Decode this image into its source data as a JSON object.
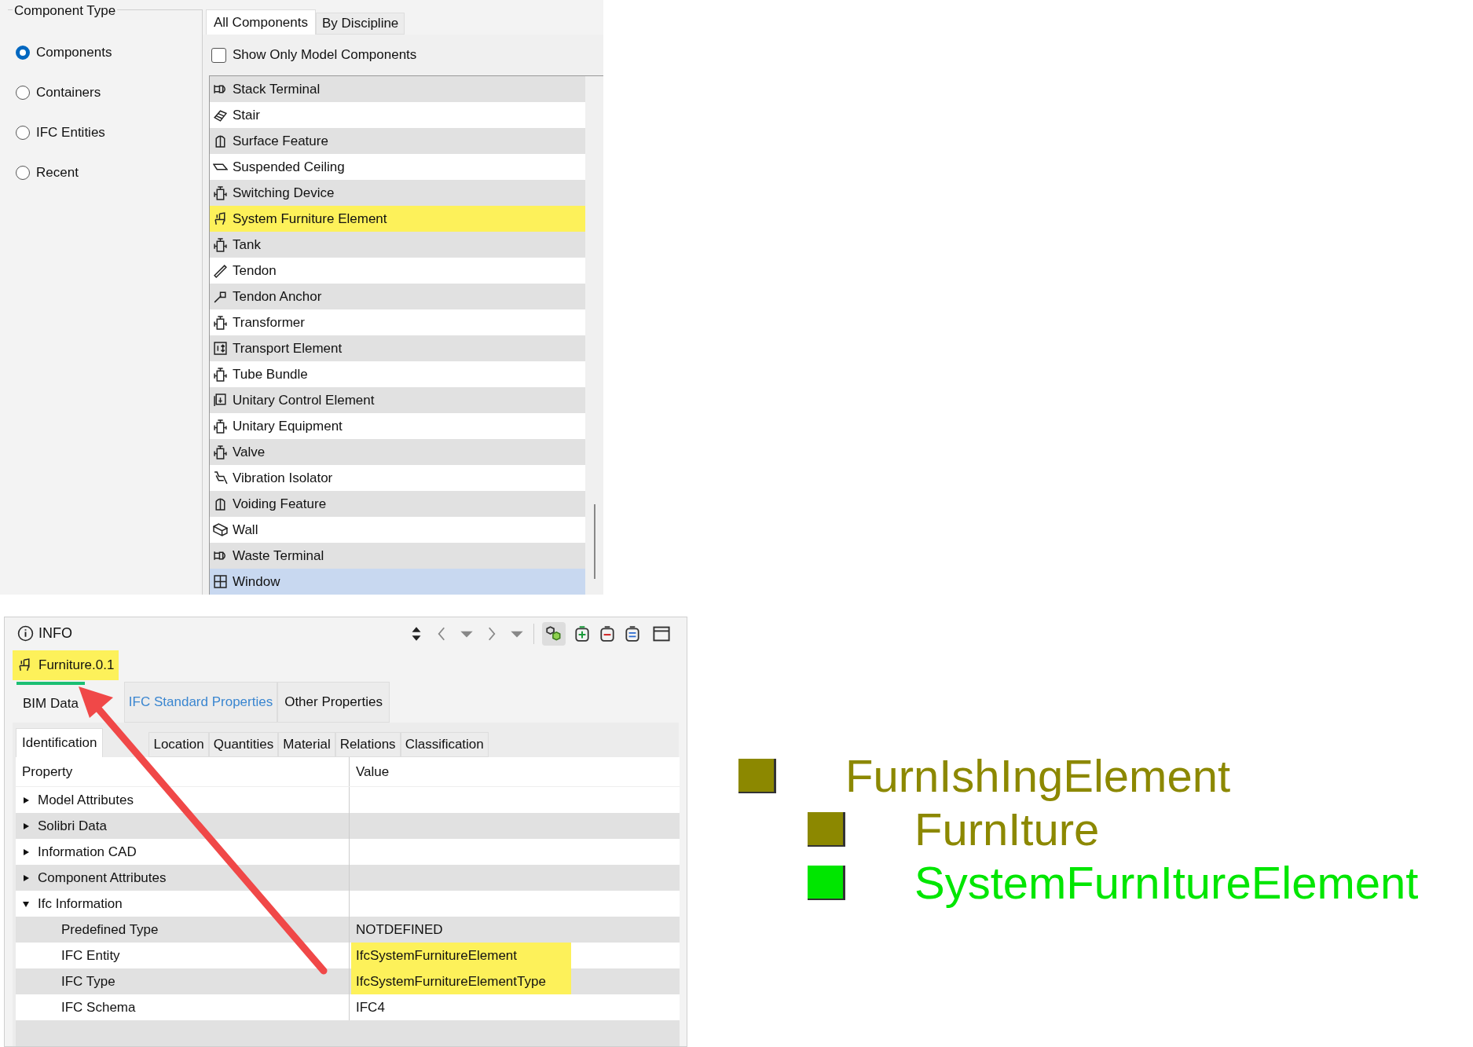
{
  "component_type": {
    "title": "Component Type",
    "options": [
      {
        "label": "Components",
        "selected": true
      },
      {
        "label": "Containers",
        "selected": false
      },
      {
        "label": "IFC Entities",
        "selected": false
      },
      {
        "label": "Recent",
        "selected": false
      }
    ]
  },
  "component_tabs": [
    {
      "label": "All Components",
      "selected": true
    },
    {
      "label": "By Discipline",
      "selected": false
    }
  ],
  "show_only_model": {
    "label": "Show Only Model Components",
    "checked": false
  },
  "components": [
    {
      "label": "Stack Terminal",
      "selected": false,
      "highlighted": false
    },
    {
      "label": "Stair",
      "selected": false,
      "highlighted": false
    },
    {
      "label": "Surface Feature",
      "selected": false,
      "highlighted": false
    },
    {
      "label": "Suspended Ceiling",
      "selected": false,
      "highlighted": false
    },
    {
      "label": "Switching Device",
      "selected": false,
      "highlighted": false
    },
    {
      "label": "System Furniture Element",
      "selected": false,
      "highlighted": true
    },
    {
      "label": "Tank",
      "selected": false,
      "highlighted": false
    },
    {
      "label": "Tendon",
      "selected": false,
      "highlighted": false
    },
    {
      "label": "Tendon Anchor",
      "selected": false,
      "highlighted": false
    },
    {
      "label": "Transformer",
      "selected": false,
      "highlighted": false
    },
    {
      "label": "Transport Element",
      "selected": false,
      "highlighted": false
    },
    {
      "label": "Tube Bundle",
      "selected": false,
      "highlighted": false
    },
    {
      "label": "Unitary Control Element",
      "selected": false,
      "highlighted": false
    },
    {
      "label": "Unitary Equipment",
      "selected": false,
      "highlighted": false
    },
    {
      "label": "Valve",
      "selected": false,
      "highlighted": false
    },
    {
      "label": "Vibration Isolator",
      "selected": false,
      "highlighted": false
    },
    {
      "label": "Voiding Feature",
      "selected": false,
      "highlighted": false
    },
    {
      "label": "Wall",
      "selected": false,
      "highlighted": false
    },
    {
      "label": "Waste Terminal",
      "selected": false,
      "highlighted": false
    },
    {
      "label": "Window",
      "selected": true,
      "highlighted": false
    }
  ],
  "info": {
    "title": "INFO",
    "object": {
      "label": "Furniture.0.1",
      "highlighted": true
    },
    "tabs": [
      {
        "label": "BIM Data",
        "selected": true
      },
      {
        "label": "IFC Standard Properties",
        "selected": false
      },
      {
        "label": "Other Properties",
        "selected": false
      }
    ],
    "subtabs": [
      {
        "label": "Identification",
        "selected": true
      },
      {
        "label": "Location",
        "selected": false
      },
      {
        "label": "Quantities",
        "selected": false
      },
      {
        "label": "Material",
        "selected": false
      },
      {
        "label": "Relations",
        "selected": false
      },
      {
        "label": "Classification",
        "selected": false
      }
    ],
    "table": {
      "columns": [
        "Property",
        "Value"
      ],
      "rows": [
        {
          "property": "Model Attributes",
          "expanded": false
        },
        {
          "property": "Solibri Data",
          "expanded": false
        },
        {
          "property": "Information CAD",
          "expanded": false
        },
        {
          "property": "Component Attributes",
          "expanded": false
        },
        {
          "property": "Ifc Information",
          "expanded": true,
          "children": [
            {
              "property": "Predefined Type",
              "value": "NOTDEFINED",
              "highlighted": false
            },
            {
              "property": "IFC Entity",
              "value": "IfcSystemFurnitureElement",
              "highlighted": true
            },
            {
              "property": "IFC Type",
              "value": "IfcSystemFurnitureElementType",
              "highlighted": true
            },
            {
              "property": "IFC Schema",
              "value": "IFC4",
              "highlighted": false
            }
          ]
        }
      ]
    }
  },
  "hierarchy": [
    {
      "label": "FurnIshIngElement",
      "color": "#8c8800",
      "children": [
        {
          "label": "FurnIture",
          "color": "#8c8800"
        },
        {
          "label": "SystemFurnItureElement",
          "color": "#00e600"
        }
      ]
    }
  ]
}
